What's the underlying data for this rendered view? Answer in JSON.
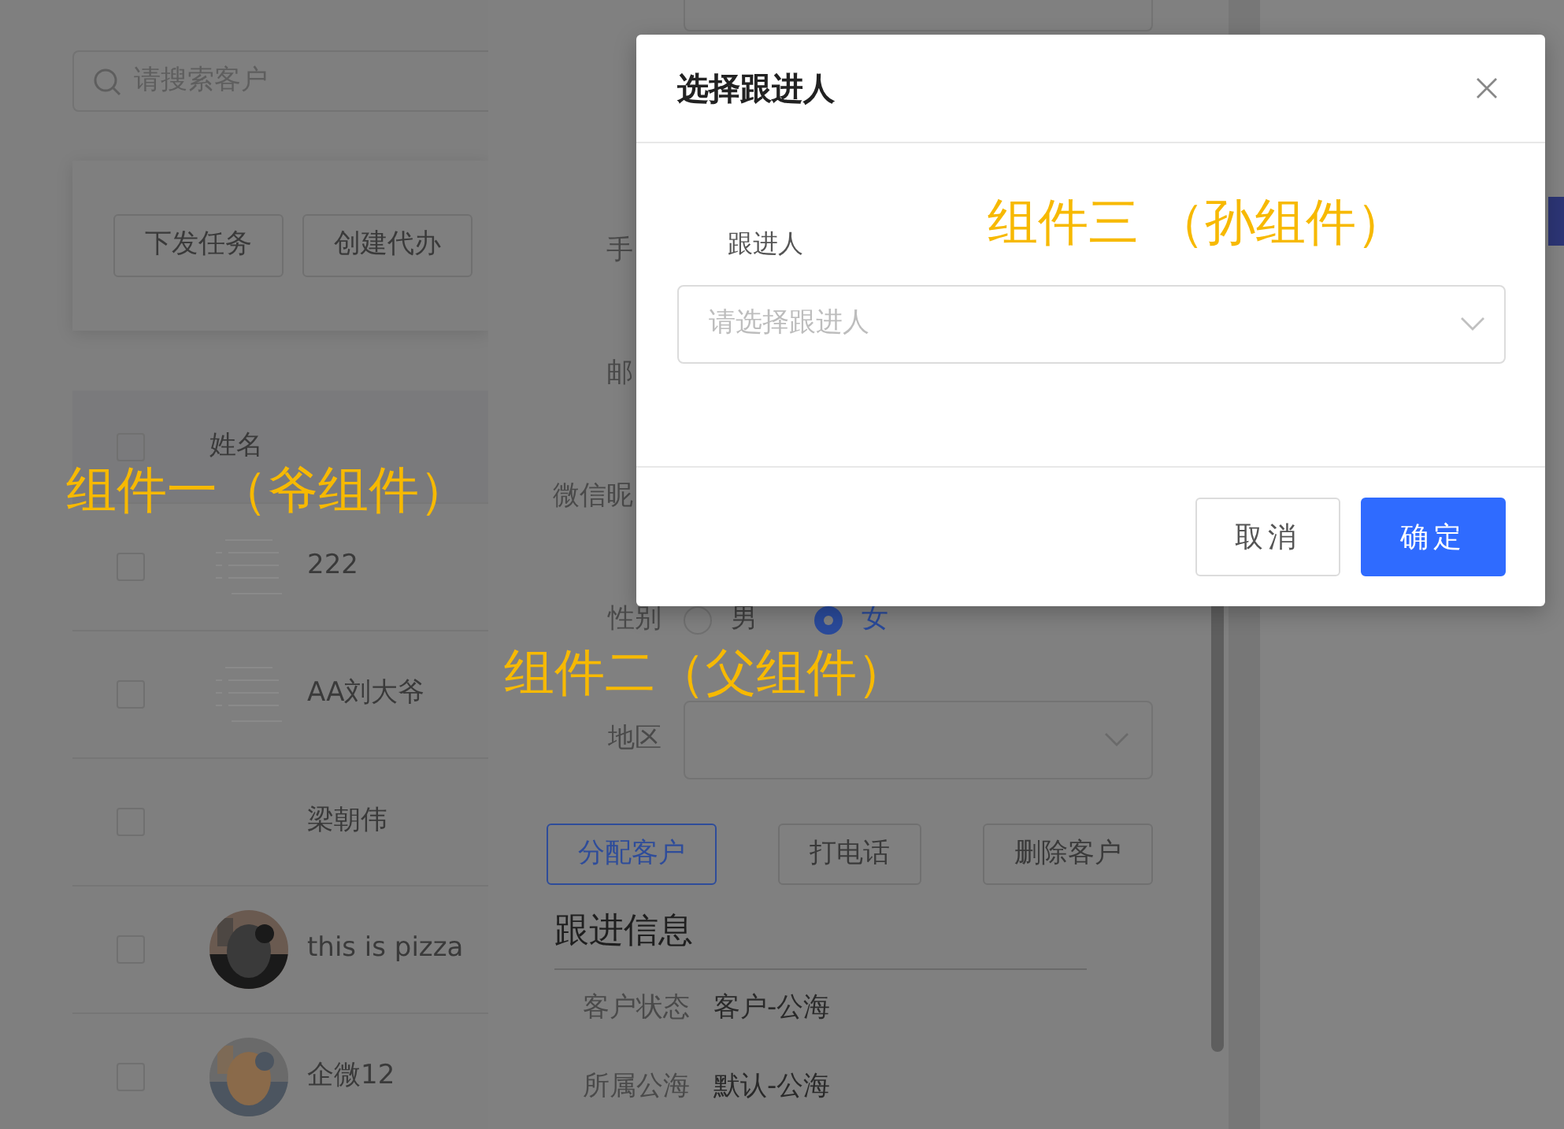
{
  "customer_list": {
    "search": {
      "placeholder": "请搜索客户"
    },
    "actions": [
      "下发任务",
      "创建代办"
    ],
    "table": {
      "columns": [
        "姓名"
      ],
      "header_checked": false,
      "rows": [
        {
          "name": "222",
          "checked": false,
          "kind": "doc"
        },
        {
          "name": "AA刘大爷",
          "checked": false,
          "kind": "doc"
        },
        {
          "name": "梁朝伟",
          "checked": false,
          "kind": "plain"
        },
        {
          "name": "this is pizza",
          "checked": false
        },
        {
          "name": "企微12",
          "checked": false
        }
      ]
    }
  },
  "drawer": {
    "form": [
      {
        "kind": "label",
        "label": "手"
      },
      {
        "kind": "label",
        "label": "邮"
      },
      {
        "kind": "label",
        "label": "微信昵"
      },
      {
        "kind": "radio",
        "label": "性别",
        "options": [
          {
            "label": "男",
            "selected": false
          },
          {
            "label": "女",
            "selected": true
          }
        ]
      },
      {
        "kind": "select",
        "label": "地区"
      }
    ],
    "buttons": [
      {
        "label": "分配客户",
        "primary": true
      },
      {
        "label": "打电话",
        "primary": false
      },
      {
        "label": "删除客户",
        "primary": false
      }
    ],
    "follow_up": {
      "title": "跟进信息",
      "items": [
        {
          "label": "客户状态",
          "value": "客户-公海"
        },
        {
          "label": "所属公海",
          "value": "默认-公海"
        }
      ]
    }
  },
  "modal": {
    "title": "选择跟进人",
    "field_label": "跟进人",
    "select": {
      "placeholder": "请选择跟进人"
    },
    "buttons": [
      {
        "label": "取消",
        "kind": "default"
      },
      {
        "label": "确定",
        "kind": "primary"
      }
    ]
  },
  "annotations": [
    {
      "text": "组件一（爷组件）",
      "kind": "grandparent"
    },
    {
      "text": "组件二（父组件）",
      "kind": "parent"
    },
    {
      "text": "组件三 （孙组件）",
      "kind": "child"
    }
  ]
}
